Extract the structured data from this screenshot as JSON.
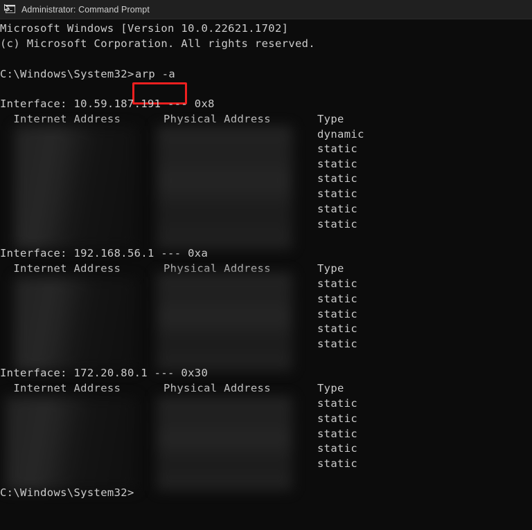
{
  "window": {
    "title": "Administrator: Command Prompt",
    "icon": "command-prompt-icon",
    "background_color": "#0c0c0c",
    "titlebar_color": "#202020",
    "text_color": "#cccccc"
  },
  "annotation": {
    "highlight_color": "#ef1f1f",
    "highlighted_text": "arp -a"
  },
  "console": {
    "banner": [
      "Microsoft Windows [Version 10.0.22621.1702]",
      "(c) Microsoft Corporation. All rights reserved."
    ],
    "prompt": "C:\\Windows\\System32>",
    "command": "arp -a",
    "final_prompt": "C:\\Windows\\System32>",
    "headers": {
      "internet_address": "  Internet Address",
      "physical_address": "Physical Address",
      "type": "Type"
    },
    "sections": [
      {
        "interface_line": "Interface: 10.59.187.191 --- 0x8",
        "interface_ip": "10.59.187.191",
        "interface_id": "0x8",
        "redacted": true,
        "entries": [
          {
            "internet_address": "",
            "physical_address": "",
            "type": "dynamic"
          },
          {
            "internet_address": "",
            "physical_address": "",
            "type": "static"
          },
          {
            "internet_address": "",
            "physical_address": "",
            "type": "static"
          },
          {
            "internet_address": "",
            "physical_address": "",
            "type": "static"
          },
          {
            "internet_address": "",
            "physical_address": "",
            "type": "static"
          },
          {
            "internet_address": "",
            "physical_address": "",
            "type": "static"
          },
          {
            "internet_address": "",
            "physical_address": "",
            "type": "static"
          }
        ]
      },
      {
        "interface_line": "Interface: 192.168.56.1 --- 0xa",
        "interface_ip": "192.168.56.1",
        "interface_id": "0xa",
        "redacted": true,
        "entries": [
          {
            "internet_address": "",
            "physical_address": "",
            "type": "static"
          },
          {
            "internet_address": "",
            "physical_address": "",
            "type": "static"
          },
          {
            "internet_address": "",
            "physical_address": "",
            "type": "static"
          },
          {
            "internet_address": "",
            "physical_address": "",
            "type": "static"
          },
          {
            "internet_address": "",
            "physical_address": "",
            "type": "static"
          }
        ]
      },
      {
        "interface_line": "Interface: 172.20.80.1 --- 0x30",
        "interface_ip": "172.20.80.1",
        "interface_id": "0x30",
        "redacted": true,
        "entries": [
          {
            "internet_address": "",
            "physical_address": "",
            "type": "static"
          },
          {
            "internet_address": "",
            "physical_address": "",
            "type": "static"
          },
          {
            "internet_address": "",
            "physical_address": "",
            "type": "static"
          },
          {
            "internet_address": "",
            "physical_address": "",
            "type": "static"
          },
          {
            "internet_address": "",
            "physical_address": "",
            "type": "static"
          }
        ]
      }
    ]
  }
}
